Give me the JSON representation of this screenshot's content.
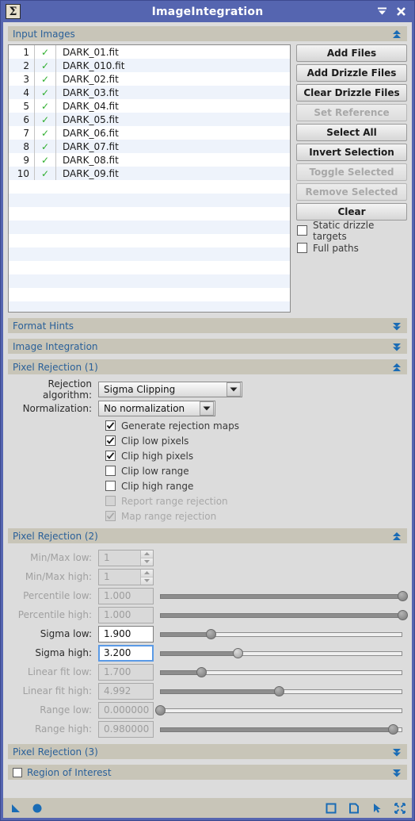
{
  "window": {
    "title": "ImageIntegration",
    "app_icon": "sigma-icon",
    "buttons": [
      {
        "name": "collapse-window-button",
        "icon": "collapse-icon"
      },
      {
        "name": "close-window-button",
        "icon": "close-icon"
      }
    ]
  },
  "sections": {
    "input_images": {
      "label": "Input Images",
      "state": "expanded",
      "arrow": "double-chevron-up-icon"
    },
    "format_hints": {
      "label": "Format Hints",
      "state": "collapsed",
      "arrow": "double-chevron-down-icon"
    },
    "image_integration": {
      "label": "Image Integration",
      "state": "collapsed",
      "arrow": "double-chevron-down-icon"
    },
    "pixel_rejection_1": {
      "label": "Pixel Rejection (1)",
      "state": "expanded",
      "arrow": "double-chevron-up-icon"
    },
    "pixel_rejection_2": {
      "label": "Pixel Rejection (2)",
      "state": "expanded",
      "arrow": "double-chevron-up-icon"
    },
    "pixel_rejection_3": {
      "label": "Pixel Rejection (3)",
      "state": "collapsed",
      "arrow": "double-chevron-down-icon"
    },
    "region_of_interest": {
      "label": "Region of Interest",
      "state": "collapsed",
      "arrow": "double-chevron-down-icon",
      "checked": false
    }
  },
  "file_list": {
    "rows": [
      {
        "index": "1",
        "checked": "✓",
        "filename": "DARK_01.fit"
      },
      {
        "index": "2",
        "checked": "✓",
        "filename": "DARK_010.fit"
      },
      {
        "index": "3",
        "checked": "✓",
        "filename": "DARK_02.fit"
      },
      {
        "index": "4",
        "checked": "✓",
        "filename": "DARK_03.fit"
      },
      {
        "index": "5",
        "checked": "✓",
        "filename": "DARK_04.fit"
      },
      {
        "index": "6",
        "checked": "✓",
        "filename": "DARK_05.fit"
      },
      {
        "index": "7",
        "checked": "✓",
        "filename": "DARK_06.fit"
      },
      {
        "index": "8",
        "checked": "✓",
        "filename": "DARK_07.fit"
      },
      {
        "index": "9",
        "checked": "✓",
        "filename": "DARK_08.fit"
      },
      {
        "index": "10",
        "checked": "✓",
        "filename": "DARK_09.fit"
      }
    ],
    "count": 10
  },
  "file_buttons": [
    {
      "label": "Add Files",
      "enabled": true
    },
    {
      "label": "Add Drizzle Files",
      "enabled": true
    },
    {
      "label": "Clear Drizzle Files",
      "enabled": true
    },
    {
      "label": "Set Reference",
      "enabled": false
    },
    {
      "label": "Select All",
      "enabled": true
    },
    {
      "label": "Invert Selection",
      "enabled": true
    },
    {
      "label": "Toggle Selected",
      "enabled": false
    },
    {
      "label": "Remove Selected",
      "enabled": false
    },
    {
      "label": "Clear",
      "enabled": true
    }
  ],
  "file_options": [
    {
      "label": "Static drizzle targets",
      "checked": false,
      "enabled": true
    },
    {
      "label": "Full paths",
      "checked": false,
      "enabled": true
    }
  ],
  "pixel_rejection_1": {
    "rejection_algorithm": {
      "label": "Rejection algorithm:",
      "value": "Sigma Clipping"
    },
    "normalization": {
      "label": "Normalization:",
      "value": "No normalization"
    },
    "checkboxes": [
      {
        "label": "Generate rejection maps",
        "checked": true,
        "enabled": true
      },
      {
        "label": "Clip low pixels",
        "checked": true,
        "enabled": true
      },
      {
        "label": "Clip high pixels",
        "checked": true,
        "enabled": true
      },
      {
        "label": "Clip low range",
        "checked": false,
        "enabled": true
      },
      {
        "label": "Clip high range",
        "checked": false,
        "enabled": true
      },
      {
        "label": "Report range rejection",
        "checked": false,
        "enabled": false
      },
      {
        "label": "Map range rejection",
        "checked": true,
        "enabled": false
      }
    ]
  },
  "pixel_rejection_2": {
    "rows": [
      {
        "label": "Min/Max low:",
        "value": "1",
        "enabled": false,
        "control": "spinner",
        "focused": false,
        "slider_pct": null
      },
      {
        "label": "Min/Max high:",
        "value": "1",
        "enabled": false,
        "control": "spinner",
        "focused": false,
        "slider_pct": null
      },
      {
        "label": "Percentile low:",
        "value": "1.000",
        "enabled": false,
        "control": "slider",
        "focused": false,
        "slider_pct": 100
      },
      {
        "label": "Percentile high:",
        "value": "1.000",
        "enabled": false,
        "control": "slider",
        "focused": false,
        "slider_pct": 100
      },
      {
        "label": "Sigma low:",
        "value": "1.900",
        "enabled": true,
        "control": "slider",
        "focused": false,
        "slider_pct": 21
      },
      {
        "label": "Sigma high:",
        "value": "3.200",
        "enabled": true,
        "control": "slider",
        "focused": true,
        "slider_pct": 32
      },
      {
        "label": "Linear fit low:",
        "value": "1.700",
        "enabled": false,
        "control": "slider",
        "focused": false,
        "slider_pct": 17
      },
      {
        "label": "Linear fit high:",
        "value": "4.992",
        "enabled": false,
        "control": "slider",
        "focused": false,
        "slider_pct": 49
      },
      {
        "label": "Range low:",
        "value": "0.000000",
        "enabled": false,
        "control": "slider",
        "focused": false,
        "slider_pct": 0
      },
      {
        "label": "Range high:",
        "value": "0.980000",
        "enabled": false,
        "control": "slider",
        "focused": false,
        "slider_pct": 96
      }
    ]
  },
  "footer": {
    "left_icons": [
      {
        "name": "real-time-preview-icon",
        "icon": "triangle-icon"
      },
      {
        "name": "global-apply-icon",
        "icon": "circle-icon"
      }
    ],
    "right_icons": [
      {
        "name": "browse-documentation-icon",
        "icon": "square-icon"
      },
      {
        "name": "new-instance-icon",
        "icon": "document-icon"
      },
      {
        "name": "apply-icon",
        "icon": "arrow-cursor-icon"
      },
      {
        "name": "reset-icon",
        "icon": "collapse-arrows-icon"
      }
    ]
  },
  "colors": {
    "titlebar": "#5565b0",
    "section_header": "#c8c5b8",
    "accent_blue": "#2a6099",
    "body_bg": "#dcdcdc",
    "list_alt_row": "#eef3fb",
    "check_green": "#2eae2e",
    "focus_blue": "#5a9ae6"
  }
}
